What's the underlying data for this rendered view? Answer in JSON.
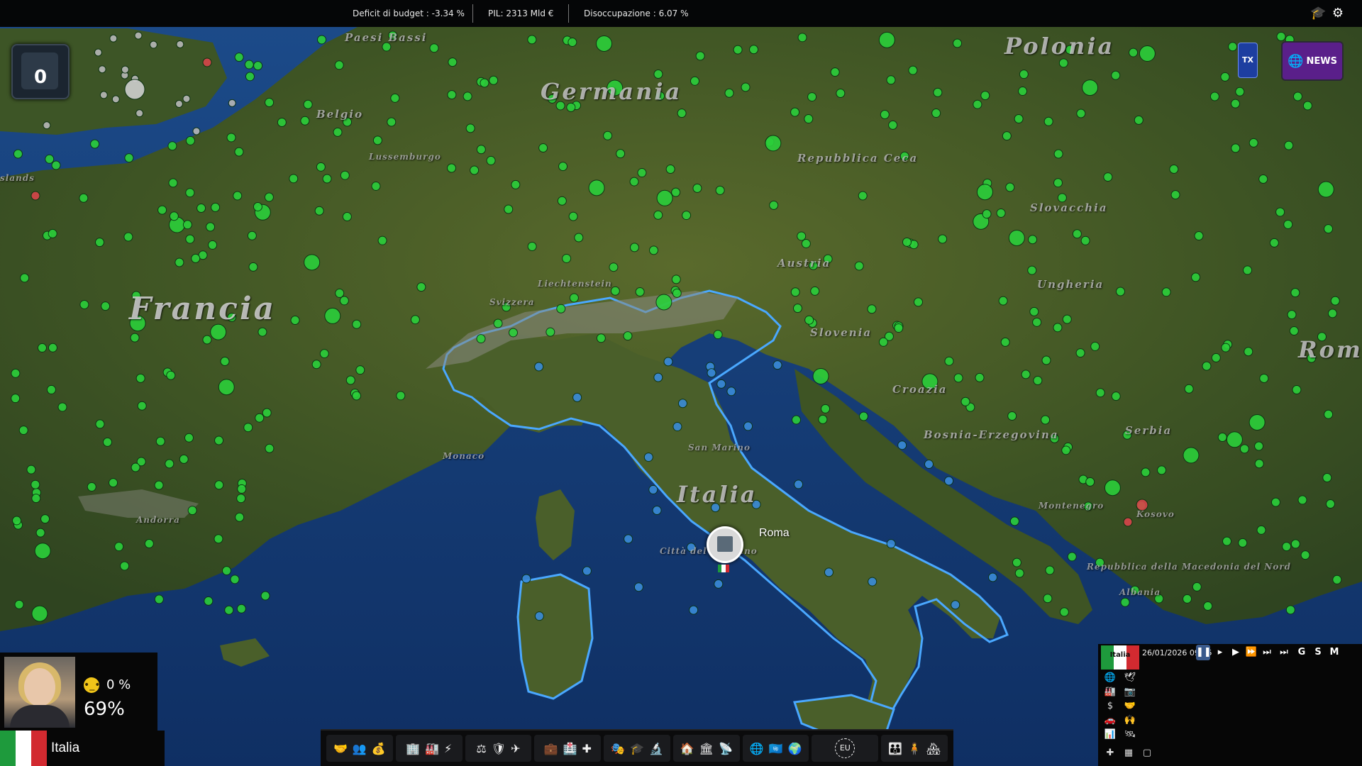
{
  "top_bar": {
    "budget_deficit": "Deficit di budget :  -3.34 %",
    "gdp": "PIL:  2313 Mld  €",
    "unemployment": "Disoccupazione :  6.07 %",
    "icons": [
      "graduation-cap-icon",
      "gear-icon"
    ]
  },
  "counter": {
    "value": "0"
  },
  "news_button": {
    "label": "NEWS",
    "icon": "globe-icon"
  },
  "tv_button": {
    "label": "TX"
  },
  "map_labels": {
    "polonia": "Polonia",
    "germania": "Germania",
    "francia": "Francia",
    "italia": "Italia",
    "paesi_bassi": "Paesi Bassi",
    "belgio": "Belgio",
    "lussemburgo": "Lussemburgo",
    "repubblica_ceca": "Repubblica Ceca",
    "slovacchia": "Slovacchia",
    "ungheria": "Ungheria",
    "austria": "Austria",
    "liechtenstein": "Liechtenstein",
    "svizzera": "Svizzera",
    "slovenia": "Slovenia",
    "croazia": "Croazia",
    "bosnia": "Bosnia-Erzegovina",
    "serbia": "Serbia",
    "romania": "Rom",
    "montenegro": "Montenegro",
    "kosovo": "Kosovo",
    "macedonia": "Repubblica della Macedonia del Nord",
    "albania": "Albania",
    "monaco": "Monaco",
    "san_marino": "San Marino",
    "citta_vaticano": "Città del Vaticano",
    "andorra": "Andorra",
    "islands": "slands"
  },
  "capital": {
    "name": "Roma"
  },
  "leader": {
    "mood_value": "0 %",
    "approval": "69%"
  },
  "country": {
    "name": "Italia",
    "flag_colors": [
      "#1e9a3c",
      "#ffffff",
      "#d22a30"
    ]
  },
  "toolbar": {
    "groups": [
      [
        "handshake-icon",
        "users-icon",
        "money-bag-icon"
      ],
      [
        "buildings-icon",
        "factory-icon",
        "lightning-icon"
      ],
      [
        "justice-scale-icon",
        "police-badge-icon",
        "gun-icon"
      ],
      [
        "briefcase-icon",
        "hospital-icon",
        "medical-cross-icon"
      ],
      [
        "theater-masks-icon",
        "graduation-cap-icon",
        "science-icon"
      ],
      [
        "house-icon",
        "government-icon",
        "broadcast-icon"
      ],
      [
        "globe-icon",
        "un-icon",
        "world-aid-icon"
      ],
      [
        "eu-icon"
      ],
      [
        "demographics-icon",
        "family-icon",
        "pension-icon"
      ]
    ],
    "eu_label": "EU"
  },
  "time_controls": {
    "date": "26/01/2026  09:35",
    "flag_label": "Italia",
    "speed_labels": [
      "G",
      "S",
      "M"
    ]
  },
  "side_menu": {
    "icons": [
      "globe-icon",
      "bird-icon",
      "factory-small-icon",
      "camera-icon",
      "dollar-icon",
      "handshake-icon",
      "car-icon",
      "hands-icon",
      "bar-chart-icon",
      "satellite-icon",
      "plus-icon",
      "grid-icon",
      "square-icon"
    ]
  },
  "colors": {
    "green_marker": "#2bcf3a",
    "blue_marker": "#3a8bd8",
    "red_marker": "#d8454a",
    "news_purple": "#5a1f8a",
    "border_blue": "#4aa8ff"
  }
}
